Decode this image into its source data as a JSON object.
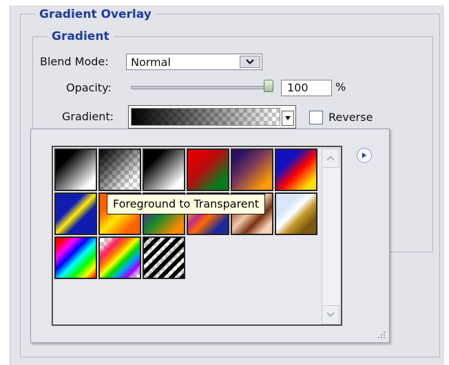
{
  "dialog": {
    "section_title": "Gradient Overlay",
    "group_title": "Gradient",
    "blend_mode": {
      "label": "Blend Mode:",
      "value": "Normal"
    },
    "opacity": {
      "label": "Opacity:",
      "value": "100",
      "unit": "%",
      "level": 1.0
    },
    "gradient": {
      "label": "Gradient:"
    },
    "reverse": {
      "label": "Reverse",
      "checked": false
    }
  },
  "picker": {
    "swatches": [
      {
        "name": "black-white",
        "icon": "gradient-swatch"
      },
      {
        "name": "foreground-to-transparent",
        "icon": "gradient-swatch"
      },
      {
        "name": "black-white-2",
        "icon": "gradient-swatch"
      },
      {
        "name": "red-green",
        "icon": "gradient-swatch"
      },
      {
        "name": "violet-orange",
        "icon": "gradient-swatch"
      },
      {
        "name": "blue-red-yellow",
        "icon": "gradient-swatch"
      },
      {
        "name": "blue-yellow-blue",
        "icon": "gradient-swatch"
      },
      {
        "name": "orange-yellow-orange",
        "icon": "gradient-swatch"
      },
      {
        "name": "violet-green-orange",
        "icon": "gradient-swatch"
      },
      {
        "name": "yellow-violet-orange-blue",
        "icon": "gradient-swatch"
      },
      {
        "name": "copper",
        "icon": "gradient-swatch"
      },
      {
        "name": "chrome",
        "icon": "gradient-swatch"
      },
      {
        "name": "spectrum",
        "icon": "gradient-swatch"
      },
      {
        "name": "transparent-rainbow",
        "icon": "gradient-swatch"
      },
      {
        "name": "transparent-stripes",
        "icon": "gradient-swatch"
      }
    ],
    "tooltip": "Foreground to Transparent"
  }
}
